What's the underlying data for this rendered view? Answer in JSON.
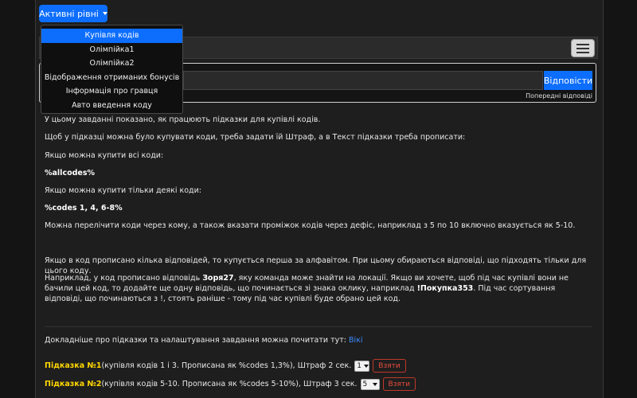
{
  "levels_button": {
    "label": "Активні рівні"
  },
  "menu": {
    "items": [
      {
        "label": "Купівля кодів",
        "active": true
      },
      {
        "label": "Олімпійка1",
        "active": false
      },
      {
        "label": "Олімпійка2",
        "active": false
      },
      {
        "label": "Відображення отриманих бонусів",
        "active": false
      },
      {
        "label": "Інформація про гравця",
        "active": false
      },
      {
        "label": "Авто введення коду",
        "active": false
      }
    ]
  },
  "answer": {
    "value": "",
    "button_label": "Відповісти",
    "previous_label": "Попередні відповіді"
  },
  "content": {
    "p1": "У цьому завданні показано, як працюють підказки для купівлі кодів.",
    "p2": "Щоб у підказці можна було купувати коди, треба задати їй Штраф, а в Текст підказки треба прописати:",
    "p3": "Якщо можна купити всі коди:",
    "p4": "%allcodes%",
    "p5": "Якщо можна купити тільки деякі коди:",
    "p6": "%codes 1, 4, 6-8%",
    "p7": "Можна перелічити коди через кому, а також вказати проміжок кодів через дефіс, наприклад з 5 по 10 включно вказується як 5-10.",
    "p8": "Якщо в код прописано кілька відповідей, то купується перша за алфавітом. При цьому обираються відповіді, що підходять тільки для цього коду.",
    "p9a": "Наприклад, у код прописано відповідь ",
    "p9b": "Зоря27",
    "p9c": ", яку команда може знайти на локації. Якщо ви хочете, щоб під час купівлі вони не бачили цей код, то додайте ще одну відповідь, що починається зі знака оклику, наприклад ",
    "p9d": "!Покупка353",
    "p9e": ". Під час сортування відповіді, що починаються з !, стоять раніше - тому під час купівлі буде обрано цей код.",
    "more_text": "Докладніше про підказки та налаштування завдання можна почитати тут: ",
    "more_link": "Вікі"
  },
  "hints": [
    {
      "title": "Підказка №1",
      "desc": "(купівля кодів 1 і 3. Прописана як %codes 1,3%), Штраф 2 сек.",
      "select_value": "1",
      "button_label": "Взяти"
    },
    {
      "title": "Підказка №2",
      "desc": "(купівля кодів 5-10. Прописана як %codes 5-10%), Штраф 3 сек.",
      "select_value": "5",
      "button_label": "Взяти"
    }
  ]
}
